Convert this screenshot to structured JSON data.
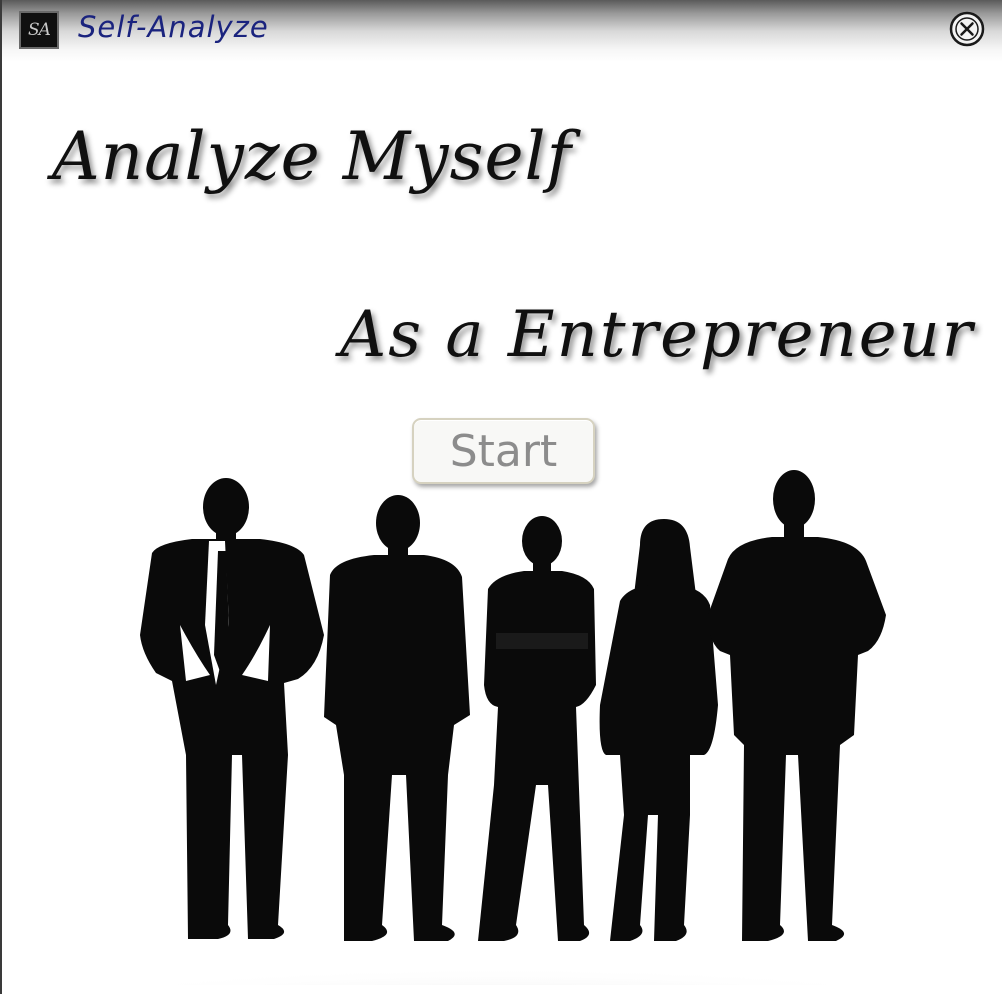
{
  "window": {
    "title": "Self-Analyze",
    "icon_text": "SA",
    "title_color": "#1a237e"
  },
  "titlebar": {
    "close_icon": "close-circle-icon"
  },
  "main": {
    "heading_primary": "Analyze Myself",
    "heading_secondary": "As a Entrepreneur",
    "start_button_label": "Start"
  },
  "illustration": {
    "subject": "business-people-silhouettes-icon"
  }
}
